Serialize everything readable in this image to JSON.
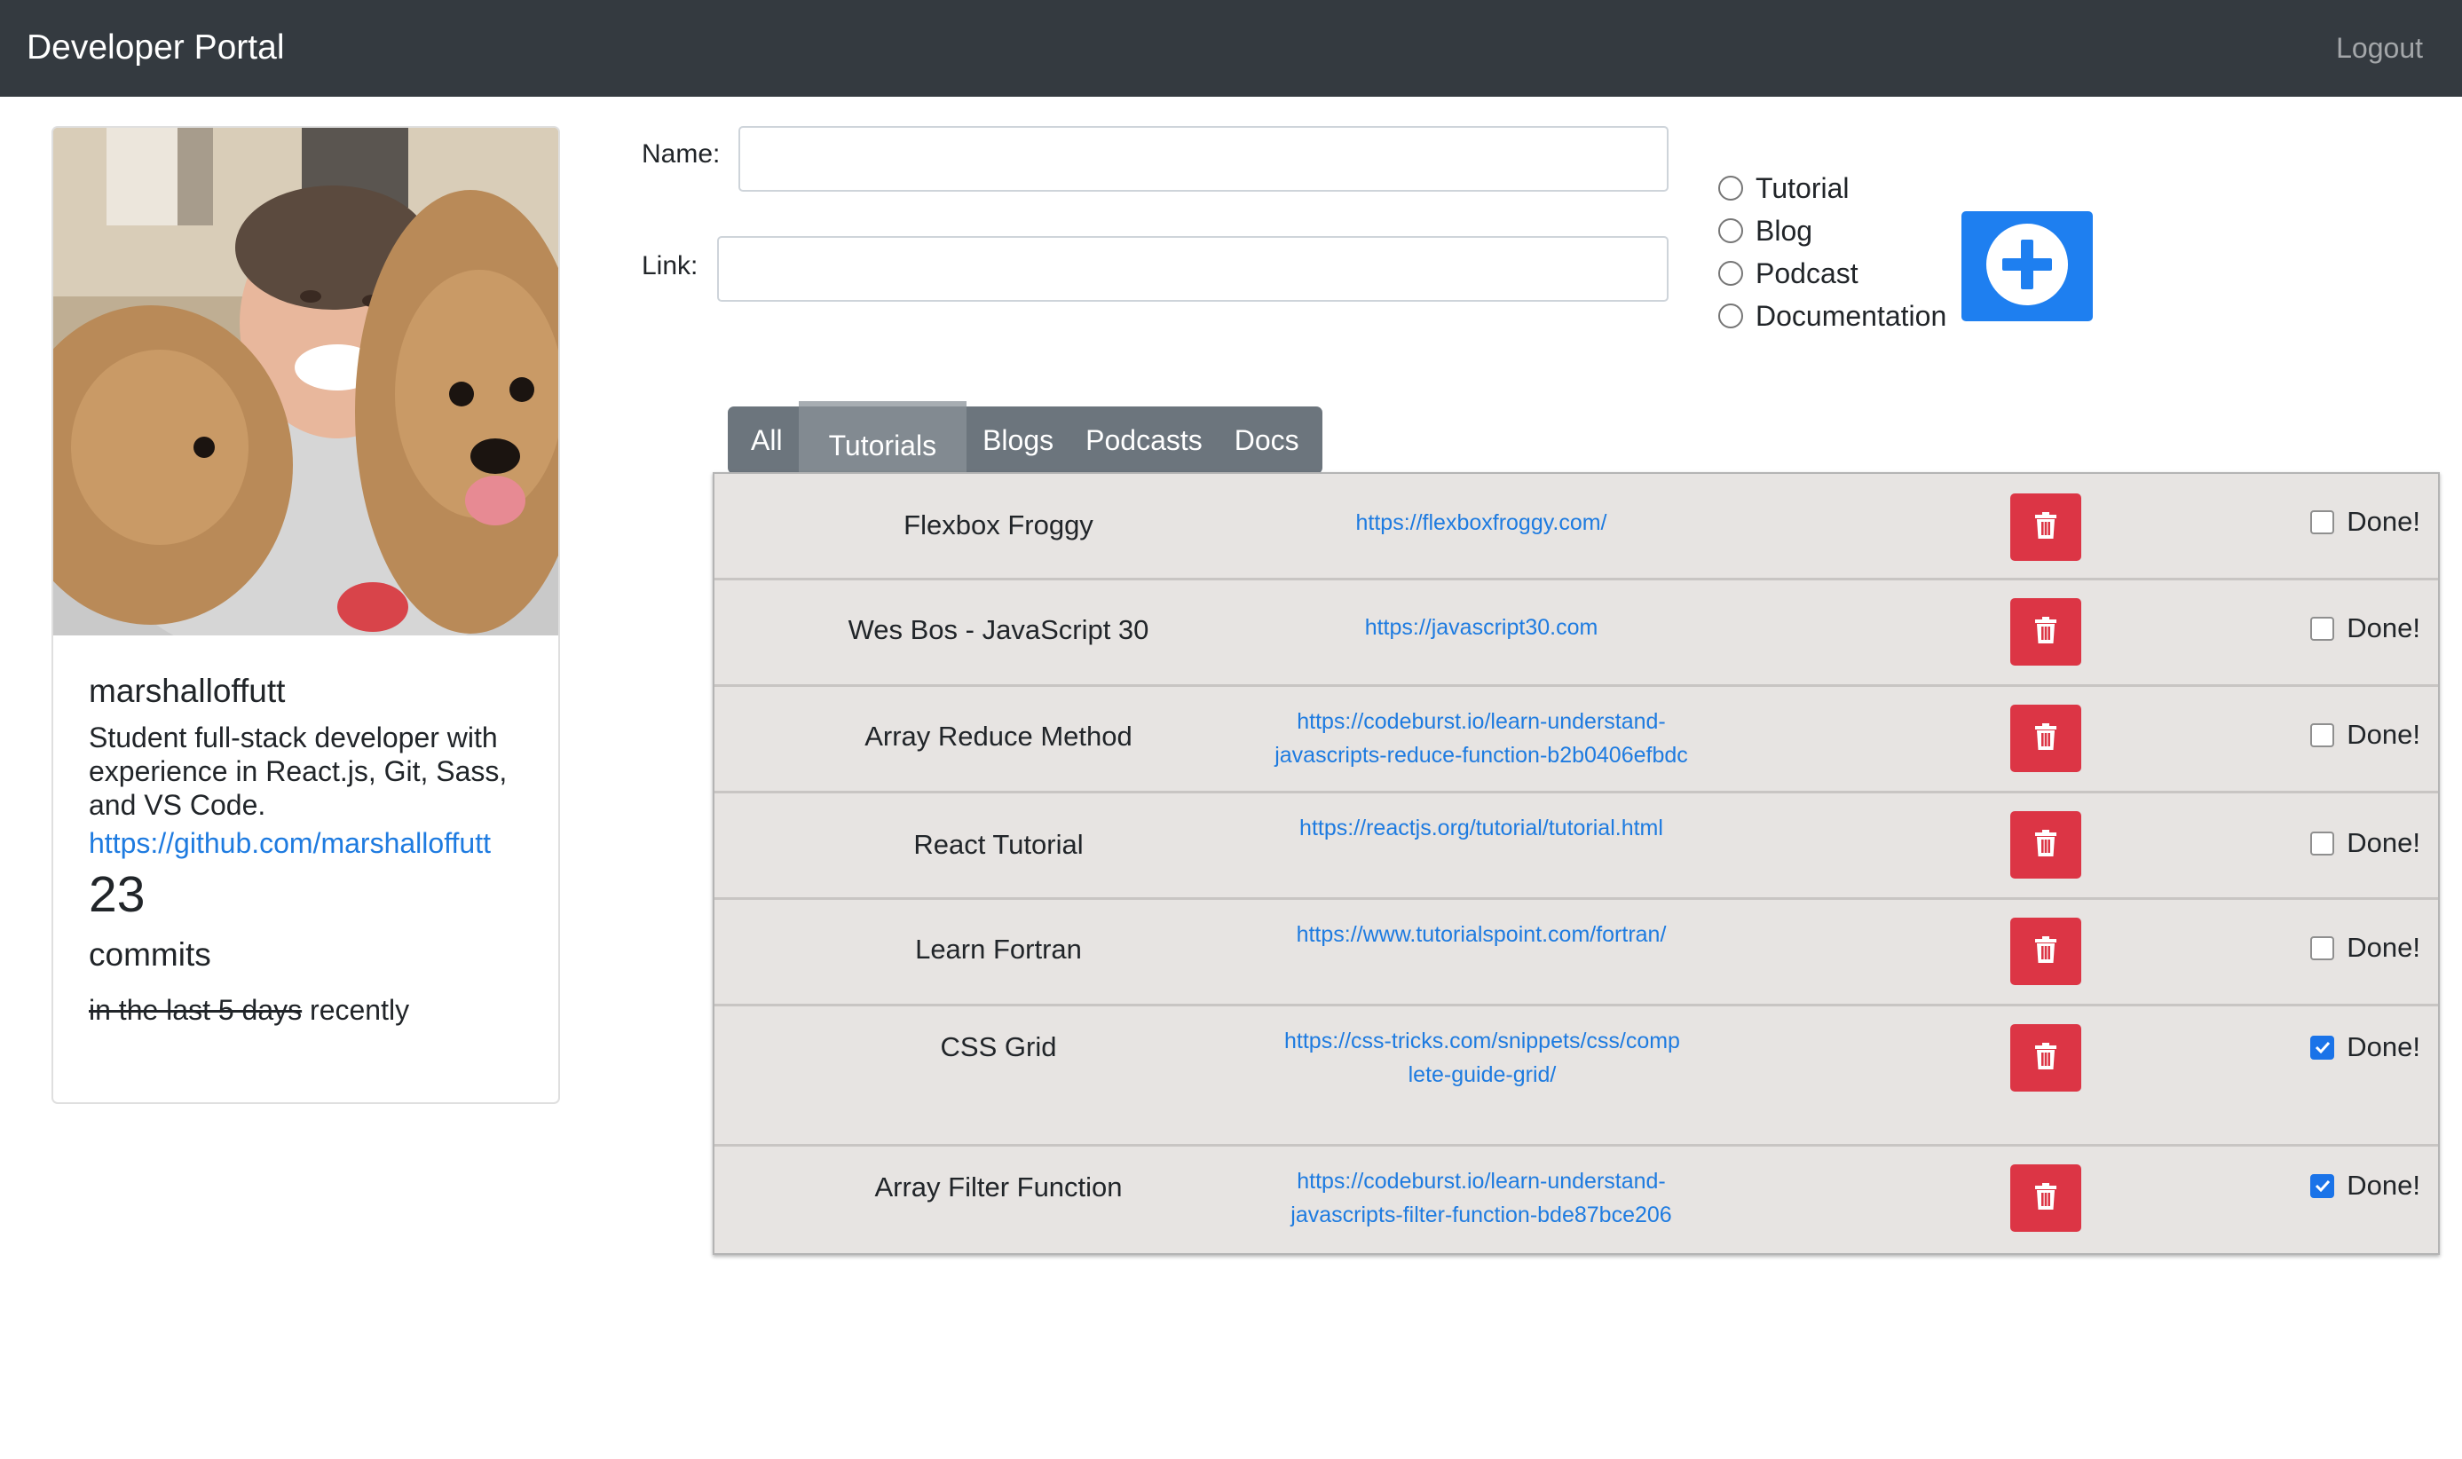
{
  "navbar": {
    "brand": "Developer Portal",
    "logout": "Logout"
  },
  "profile": {
    "username": "marshalloffutt",
    "bio": "Student full-stack developer with experience in React.js, Git, Sass, and VS Code.",
    "github_url": "https://github.com/marshalloffutt",
    "commit_count": "23",
    "commit_label": "commits",
    "period_struck": "in the last 5 days",
    "period_current": "recently"
  },
  "form": {
    "name_label": "Name:",
    "name_value": "",
    "link_label": "Link:",
    "link_value": "",
    "types": [
      "Tutorial",
      "Blog",
      "Podcast",
      "Documentation"
    ],
    "add_icon": "plus-circle-icon",
    "add_color": "#1e7ff0"
  },
  "tabs": [
    {
      "label": "All",
      "active": false
    },
    {
      "label": "Tutorials",
      "active": true
    },
    {
      "label": "Blogs",
      "active": false
    },
    {
      "label": "Podcasts",
      "active": false
    },
    {
      "label": "Docs",
      "active": false
    }
  ],
  "resources": [
    {
      "name": "Flexbox Froggy",
      "link": "https://flexboxfroggy.com/",
      "done_label": "Done!",
      "done": false
    },
    {
      "name": "Wes Bos - JavaScript 30",
      "link": "https://javascript30.com",
      "done_label": "Done!",
      "done": false
    },
    {
      "name": "Array Reduce Method",
      "link": "https://codeburst.io/learn-understand-javascripts-reduce-function-b2b0406efbdc",
      "done_label": "Done!",
      "done": false
    },
    {
      "name": "React Tutorial",
      "link": "https://reactjs.org/tutorial/tutorial.html",
      "done_label": "Done!",
      "done": false
    },
    {
      "name": "Learn Fortran",
      "link": "https://www.tutorialspoint.com/fortran/",
      "done_label": "Done!",
      "done": false
    },
    {
      "name": "CSS Grid",
      "link": "https://css-tricks.com/snippets/css/complete-guide-grid/",
      "done_label": "Done!",
      "done": true
    },
    {
      "name": "Array Filter Function",
      "link": "https://codeburst.io/learn-understand-javascripts-filter-function-bde87bce206",
      "done_label": "Done!",
      "done": true
    }
  ],
  "colors": {
    "navbar": "#343a40",
    "delete": "#dc3545",
    "link": "#1e7be0",
    "row_bg": "#e7e4e2",
    "tabs_bg": "#6c757d"
  }
}
